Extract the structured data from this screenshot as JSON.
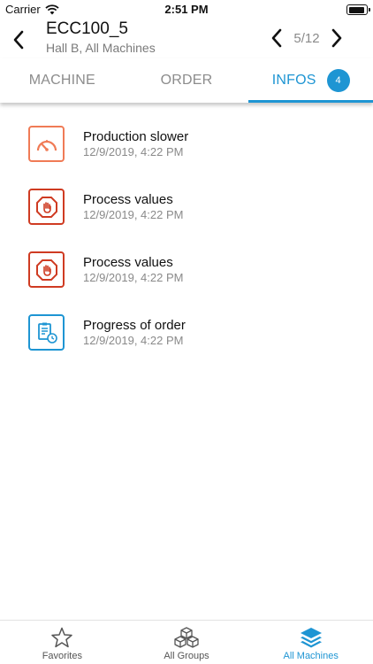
{
  "status": {
    "carrier": "Carrier",
    "time": "2:51 PM"
  },
  "header": {
    "title": "ECC100_5",
    "subtitle": "Hall B, All Machines",
    "pager": "5/12"
  },
  "tabs": [
    {
      "label": "MACHINE"
    },
    {
      "label": "ORDER"
    },
    {
      "label": "INFOS",
      "badge": "4"
    }
  ],
  "items": [
    {
      "label": "Production slower",
      "date": "12/9/2019, 4:22 PM",
      "icon": "gauge-icon",
      "color": "#f07b56"
    },
    {
      "label": "Process values",
      "date": "12/9/2019, 4:22 PM",
      "icon": "stop-hand-icon",
      "color": "#cf3b22"
    },
    {
      "label": "Process values",
      "date": "12/9/2019, 4:22 PM",
      "icon": "stop-hand-icon",
      "color": "#cf3b22"
    },
    {
      "label": "Progress of order",
      "date": "12/9/2019, 4:22 PM",
      "icon": "order-progress-icon",
      "color": "#1e95d3"
    }
  ],
  "tabbar": [
    {
      "label": "Favorites",
      "icon": "star-icon"
    },
    {
      "label": "All Groups",
      "icon": "cubes-icon"
    },
    {
      "label": "All Machines",
      "icon": "layers-icon"
    }
  ],
  "colors": {
    "accent": "#1e95d3",
    "warning": "#f07b56",
    "error": "#cf3b22"
  }
}
